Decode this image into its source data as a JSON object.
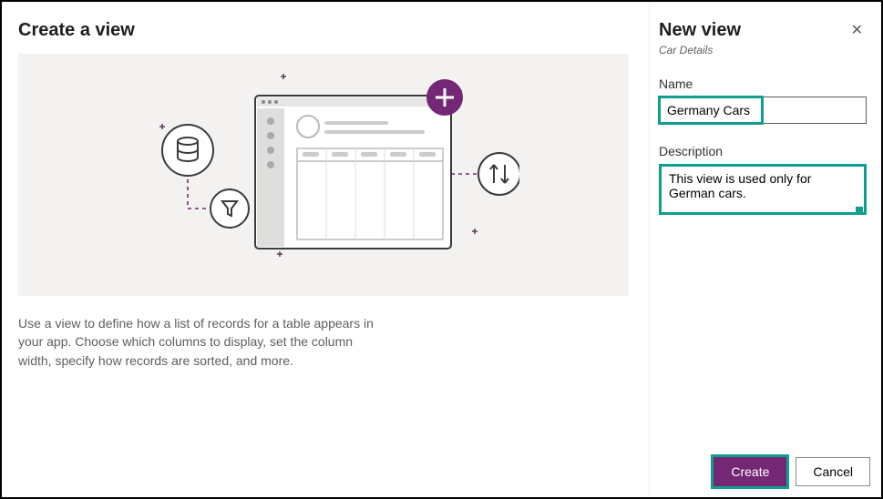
{
  "left": {
    "title": "Create a view",
    "description": "Use a view to define how a list of records for a table appears in your app. Choose which columns to display, set the column width, specify how records are sorted, and more."
  },
  "right": {
    "title": "New view",
    "subtitle": "Car Details",
    "name_label": "Name",
    "name_value": "Germany Cars",
    "description_label": "Description",
    "description_value": "This view is used only for German cars."
  },
  "footer": {
    "create_label": "Create",
    "cancel_label": "Cancel"
  },
  "colors": {
    "accent": "#742774",
    "highlight": "#0f9e8e"
  }
}
